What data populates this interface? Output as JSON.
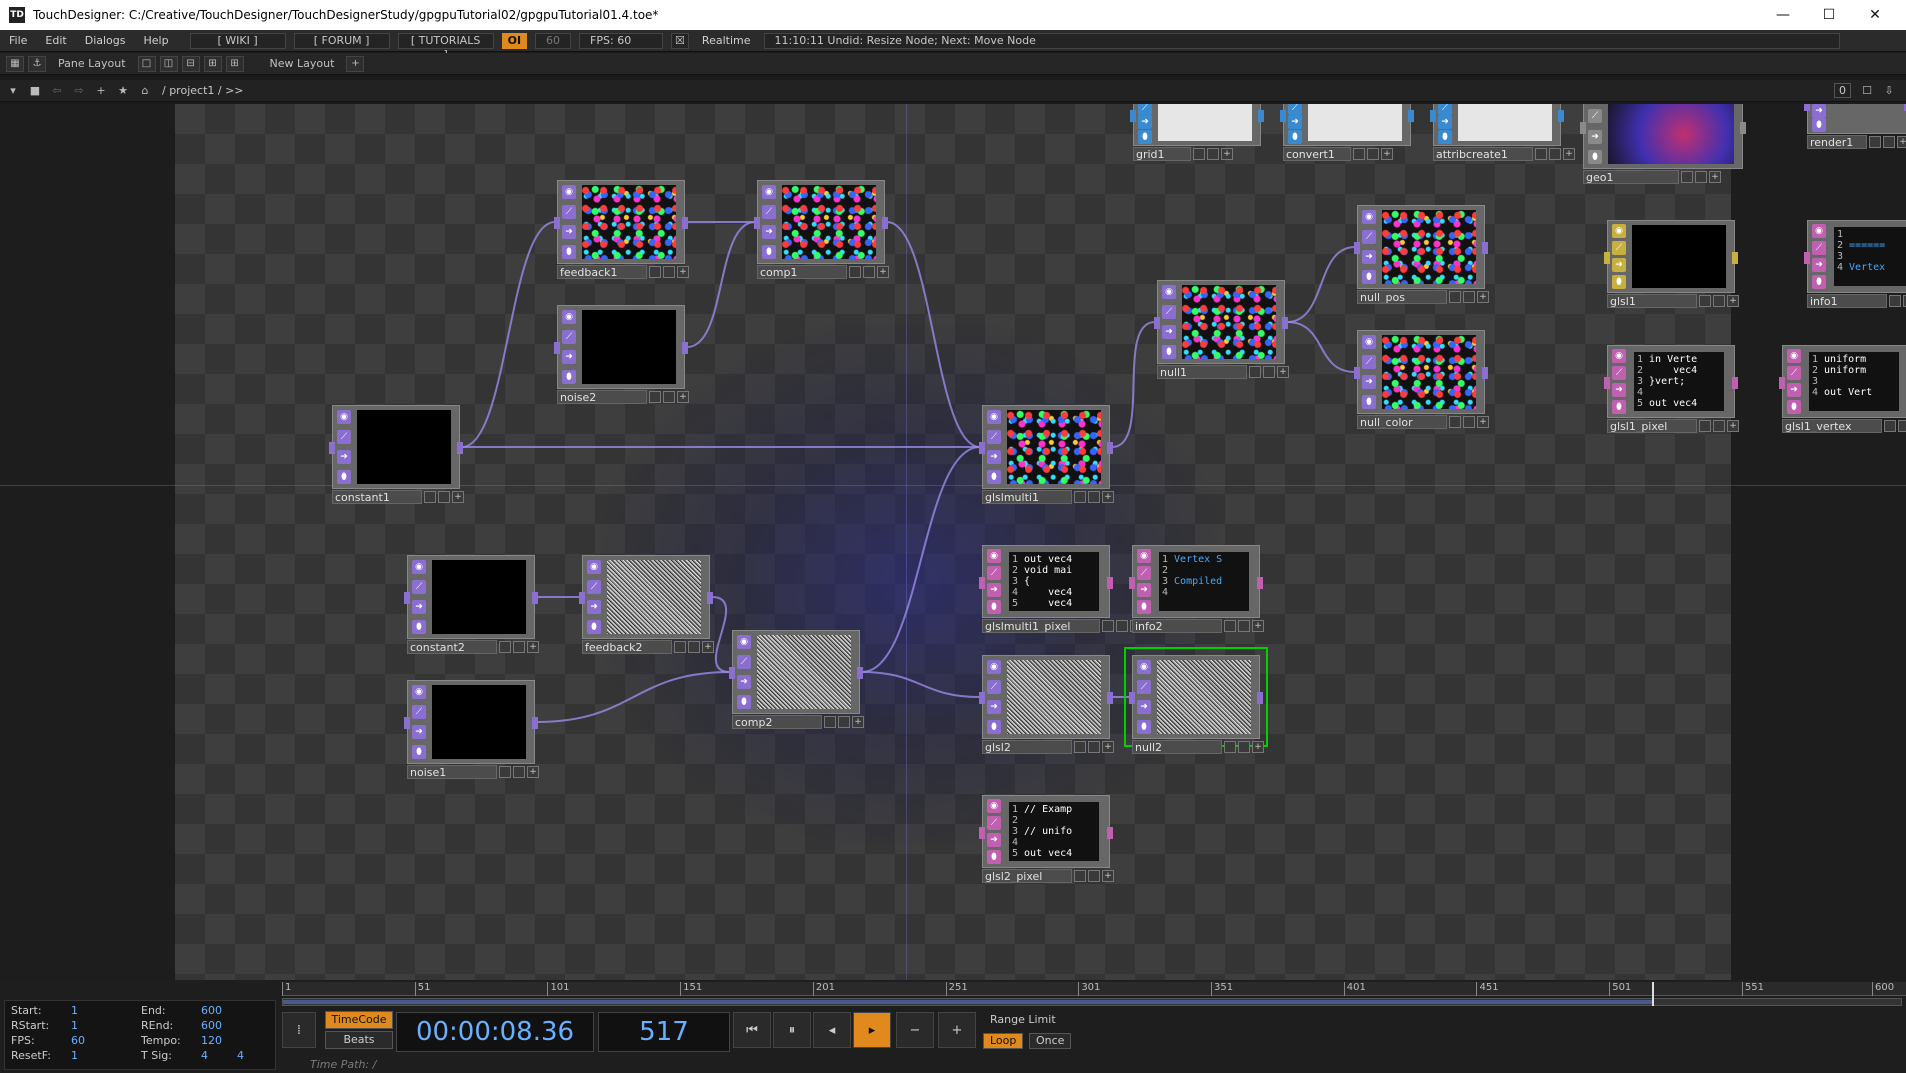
{
  "window": {
    "title": "TouchDesigner: C:/Creative/TouchDesigner/TouchDesignerStudy/gpgpuTutorial02/gpgpuTutorial01.4.toe*",
    "icon_text": "TD"
  },
  "menu": {
    "items": [
      "File",
      "Edit",
      "Dialogs",
      "Help"
    ],
    "wiki": "[ WIKI ]",
    "forum": "[ FORUM ]",
    "tutorials": "[ TUTORIALS ]",
    "oi": "OI",
    "fps_cap": "60",
    "fps": "FPS: 60",
    "realtime": "Realtime",
    "status": "11:10:11 Undid: Resize Node; Next: Move Node"
  },
  "panebar": {
    "pane_layout": "Pane Layout",
    "new_layout": "New Layout"
  },
  "pathbar": {
    "path": "/ project1 / >>",
    "counter": "0"
  },
  "nodes": [
    {
      "id": "grid1",
      "label": "grid1",
      "family": "sop",
      "thumb": "white"
    },
    {
      "id": "convert1",
      "label": "convert1",
      "family": "sop",
      "thumb": "white"
    },
    {
      "id": "attribcreate1",
      "label": "attribcreate1",
      "family": "sop",
      "thumb": "white"
    },
    {
      "id": "geo1",
      "label": "geo1",
      "family": "comp",
      "thumb": "purple"
    },
    {
      "id": "render1",
      "label": "render1",
      "family": "top"
    },
    {
      "id": "feedback1",
      "label": "feedback1",
      "family": "top",
      "thumb": "noise"
    },
    {
      "id": "comp1",
      "label": "comp1",
      "family": "top",
      "thumb": "noise"
    },
    {
      "id": "noise2",
      "label": "noise2",
      "family": "top",
      "thumb": "black"
    },
    {
      "id": "constant1",
      "label": "constant1",
      "family": "top",
      "thumb": "black"
    },
    {
      "id": "null_pos",
      "label": "null_pos",
      "family": "top",
      "thumb": "noise"
    },
    {
      "id": "null1",
      "label": "null1",
      "family": "top",
      "thumb": "noise"
    },
    {
      "id": "null_color",
      "label": "null_color",
      "family": "top",
      "thumb": "noise"
    },
    {
      "id": "glsl1",
      "label": "glsl1",
      "family": "mat",
      "thumb": "black"
    },
    {
      "id": "info1",
      "label": "info1",
      "family": "dat",
      "code": [
        "",
        "======",
        "",
        "Vertex"
      ]
    },
    {
      "id": "glsl1_pixel",
      "label": "glsl1_pixel",
      "family": "dat",
      "code": [
        "in Verte",
        "    vec4",
        "}vert;",
        "",
        "out vec4"
      ]
    },
    {
      "id": "glsl1_vertex",
      "label": "glsl1_vertex",
      "family": "dat",
      "code": [
        "uniform",
        "uniform",
        "",
        "out Vert"
      ]
    },
    {
      "id": "glslmulti1",
      "label": "glslmulti1",
      "family": "top",
      "thumb": "noise"
    },
    {
      "id": "glslmulti1_pixel",
      "label": "glslmulti1_pixel",
      "family": "dat",
      "code": [
        "out vec4",
        "void mai",
        "{",
        "    vec4",
        "    vec4"
      ]
    },
    {
      "id": "info2",
      "label": "info2",
      "family": "dat",
      "code": [
        "Vertex S",
        "",
        "Compiled",
        ""
      ]
    },
    {
      "id": "constant2",
      "label": "constant2",
      "family": "top",
      "thumb": "black"
    },
    {
      "id": "feedback2",
      "label": "feedback2",
      "family": "top",
      "thumb": "static"
    },
    {
      "id": "comp2",
      "label": "comp2",
      "family": "top",
      "thumb": "static"
    },
    {
      "id": "noise1",
      "label": "noise1",
      "family": "top",
      "thumb": "black"
    },
    {
      "id": "glsl2",
      "label": "glsl2",
      "family": "top",
      "thumb": "static"
    },
    {
      "id": "null2",
      "label": "null2",
      "family": "top",
      "thumb": "static",
      "selected": true
    },
    {
      "id": "glsl2_pixel",
      "label": "glsl2_pixel",
      "family": "dat",
      "code": [
        "// Examp",
        "",
        "// unifo",
        "",
        "out vec4"
      ]
    }
  ],
  "timeline": {
    "ruler": [
      "1",
      "51",
      "101",
      "151",
      "201",
      "251",
      "301",
      "351",
      "401",
      "451",
      "501",
      "551",
      "600"
    ],
    "current_frame_value": 517,
    "frame_range": [
      1,
      600
    ],
    "stats": {
      "start_label": "Start:",
      "start": "1",
      "end_label": "End:",
      "end": "600",
      "rstart_label": "RStart:",
      "rstart": "1",
      "rend_label": "REnd:",
      "rend": "600",
      "fps_label": "FPS:",
      "fps": "60",
      "tempo_label": "Tempo:",
      "tempo": "120",
      "resetf_label": "ResetF:",
      "resetf": "1",
      "tsig_label": "T Sig:",
      "tsig_a": "4",
      "tsig_b": "4"
    },
    "timecode_btn": "TimeCode",
    "beats_btn": "Beats",
    "timecode": "00:00:08.36",
    "frame": "517",
    "range_limit": "Range Limit",
    "loop": "Loop",
    "once": "Once",
    "time_path": "Time Path: /",
    "transport": [
      "rewind-icon",
      "pause-icon",
      "step-back-icon",
      "play-icon",
      "minus-icon",
      "plus-icon"
    ],
    "colors": {
      "accent": "#e08a1e",
      "value": "#6ab0ff"
    }
  },
  "colors": {
    "top": "#8a6fd0",
    "dat": "#c060b0",
    "sop": "#3a8ad0",
    "mat": "#c8b040",
    "comp": "#8a8a8a",
    "selected": "#00d000",
    "wire": "#9b8ae8"
  }
}
